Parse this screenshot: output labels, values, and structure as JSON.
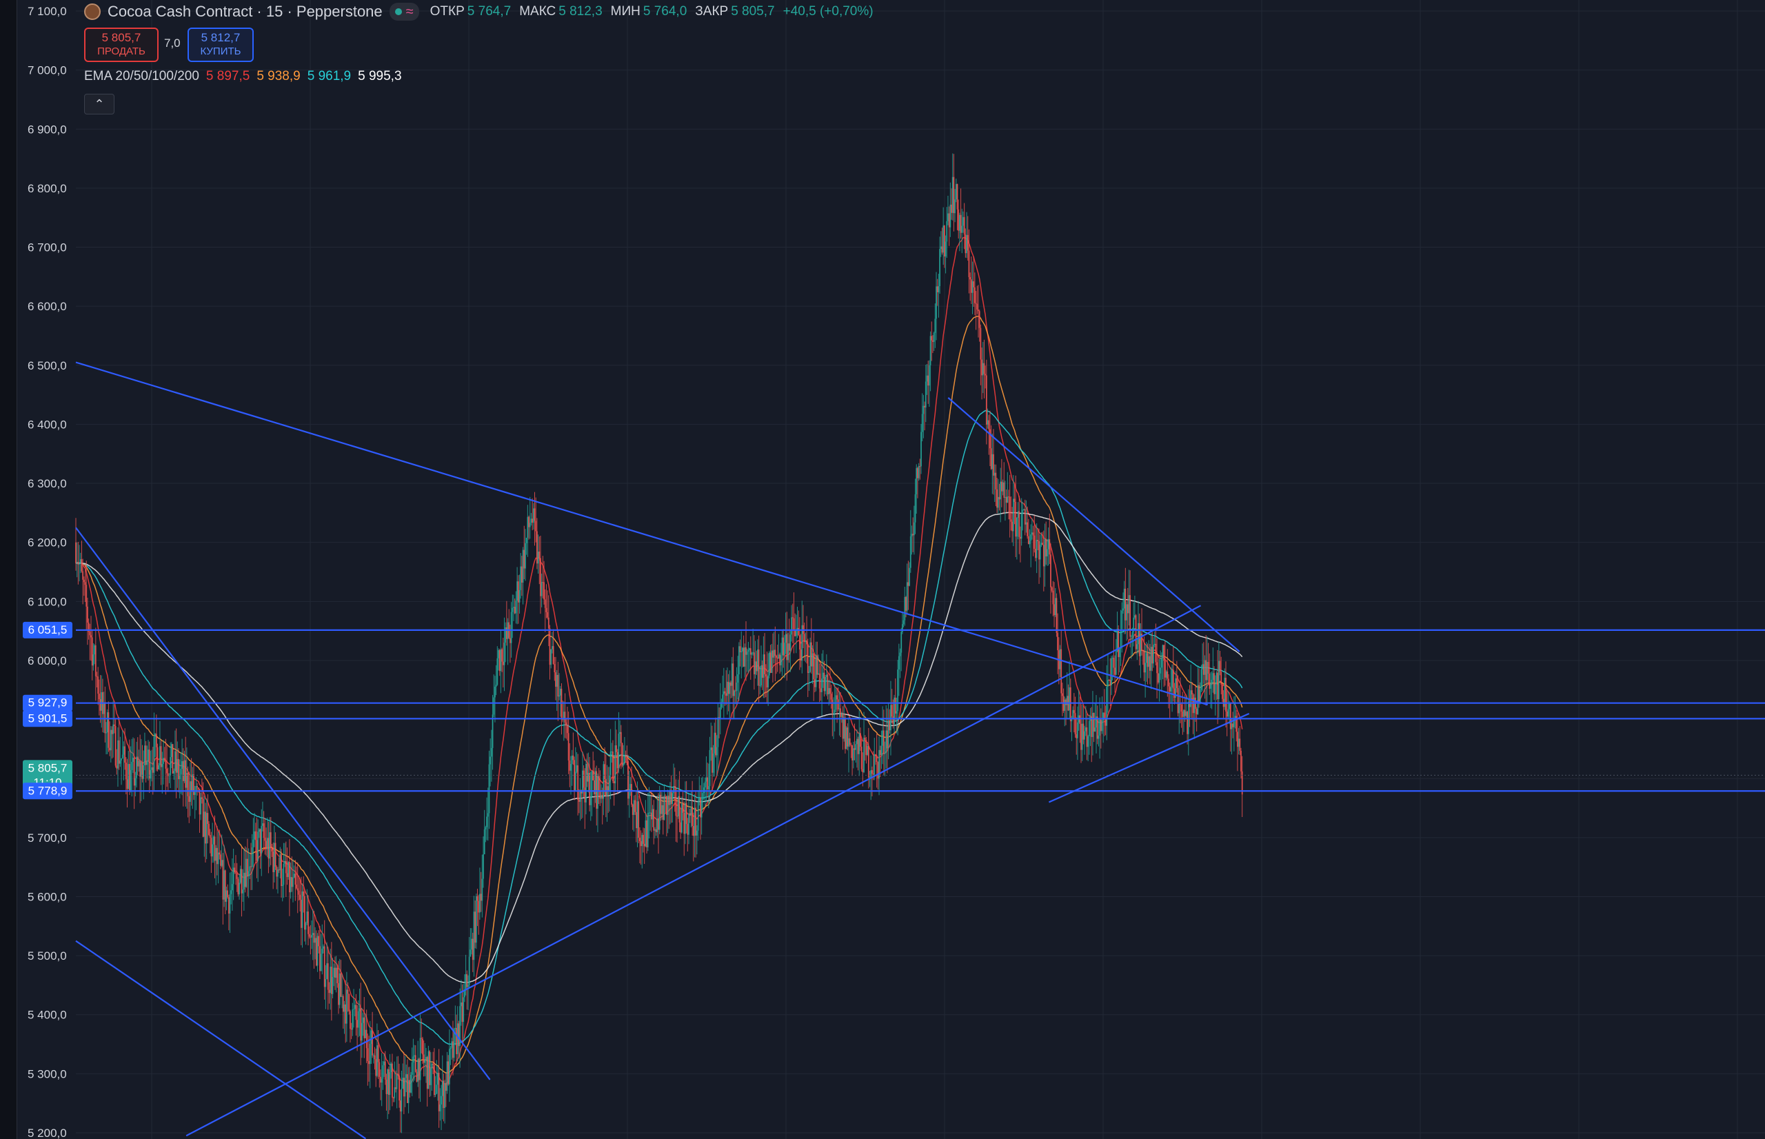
{
  "header": {
    "title": "Cocoa Cash Contract · 15 · Pepperstone",
    "ohlc": [
      {
        "key": "ОТКР",
        "value": "5 764,7"
      },
      {
        "key": "МАКС",
        "value": "5 812,3"
      },
      {
        "key": "МИН",
        "value": "5 764,0"
      },
      {
        "key": "ЗАКР",
        "value": "5 805,7"
      }
    ],
    "change": "+40,5 (+0,70%)"
  },
  "trade": {
    "sell_price": "5 805,7",
    "sell_label": "ПРОДАТЬ",
    "spread": "7,0",
    "buy_price": "5 812,7",
    "buy_label": "КУПИТЬ"
  },
  "ema": {
    "label": "EMA 20/50/100/200",
    "v20": "5 897,5",
    "v50": "5 938,9",
    "v100": "5 961,9",
    "v200": "5 995,3"
  },
  "colors": {
    "background": "#161b27",
    "grid": "#222836",
    "up": "#26a69a",
    "down": "#ef5350",
    "ema20": "#ef3b3b",
    "ema50": "#ff9a3c",
    "ema100": "#29d0d8",
    "ema200": "#e8e8e8",
    "drawing": "#2f5bff"
  },
  "icons": {
    "collapse": "chevron-up-icon",
    "logo": "cocoa-logo-icon"
  },
  "chart_data": {
    "type": "candlestick",
    "y_axis": {
      "min": 5200,
      "max": 7100,
      "ticks": [
        "7 100,0",
        "7 000,0",
        "6 900,0",
        "6 800,0",
        "6 700,0",
        "6 600,0",
        "6 500,0",
        "6 400,0",
        "6 300,0",
        "6 200,0",
        "6 100,0",
        "6 000,0",
        "5 700,0",
        "5 600,0",
        "5 500,0",
        "5 400,0",
        "5 300,0",
        "5 200,0"
      ],
      "tick_values": [
        7100,
        7000,
        6900,
        6800,
        6700,
        6600,
        6500,
        6400,
        6300,
        6200,
        6100,
        6000,
        5700,
        5600,
        5500,
        5400,
        5300,
        5200
      ]
    },
    "price_badges": [
      {
        "label": "6 051,5",
        "value": 6051.5,
        "color": "#2962ff"
      },
      {
        "label": "5 927,9",
        "value": 5927.9,
        "color": "#2962ff"
      },
      {
        "label": "5 901,5",
        "value": 5901.5,
        "color": "#2962ff"
      },
      {
        "label": "5 805,7",
        "sub": "11:10",
        "value": 5805.7,
        "color": "#26a69a"
      },
      {
        "label": "5 778,9",
        "value": 5778.9,
        "color": "#2962ff"
      }
    ],
    "horizontal_levels": [
      6051.5,
      5927.9,
      5901.5,
      5778.9
    ],
    "last_price": 5805.7,
    "trendlines": [
      {
        "t1": 0,
        "p1": 6505,
        "t2": 0.82,
        "p2": 5925
      },
      {
        "t1": 0,
        "p1": 6225,
        "t2": 0.3,
        "p2": 5290
      },
      {
        "t1": 0,
        "p1": 5525,
        "t2": 0.21,
        "p2": 5190
      },
      {
        "t1": 0.08,
        "p1": 5195,
        "t2": 0.815,
        "p2": 6093
      },
      {
        "t1": 0.705,
        "p1": 5760,
        "t2": 0.85,
        "p2": 5910
      },
      {
        "t1": 0.632,
        "p1": 6445,
        "t2": 0.843,
        "p2": 6015
      }
    ],
    "price_path": [
      {
        "t": 0,
        "p": 6200
      },
      {
        "t": 0.02,
        "p": 5900
      },
      {
        "t": 0.04,
        "p": 5800
      },
      {
        "t": 0.06,
        "p": 5850
      },
      {
        "t": 0.085,
        "p": 5780
      },
      {
        "t": 0.11,
        "p": 5600
      },
      {
        "t": 0.135,
        "p": 5700
      },
      {
        "t": 0.16,
        "p": 5600
      },
      {
        "t": 0.18,
        "p": 5480
      },
      {
        "t": 0.2,
        "p": 5400
      },
      {
        "t": 0.22,
        "p": 5320
      },
      {
        "t": 0.235,
        "p": 5260
      },
      {
        "t": 0.25,
        "p": 5330
      },
      {
        "t": 0.265,
        "p": 5260
      },
      {
        "t": 0.28,
        "p": 5400
      },
      {
        "t": 0.295,
        "p": 5650
      },
      {
        "t": 0.305,
        "p": 6000
      },
      {
        "t": 0.315,
        "p": 6050
      },
      {
        "t": 0.33,
        "p": 6250
      },
      {
        "t": 0.345,
        "p": 6000
      },
      {
        "t": 0.36,
        "p": 5800
      },
      {
        "t": 0.38,
        "p": 5780
      },
      {
        "t": 0.395,
        "p": 5850
      },
      {
        "t": 0.41,
        "p": 5700
      },
      {
        "t": 0.43,
        "p": 5760
      },
      {
        "t": 0.45,
        "p": 5720
      },
      {
        "t": 0.465,
        "p": 5880
      },
      {
        "t": 0.48,
        "p": 6000
      },
      {
        "t": 0.5,
        "p": 5980
      },
      {
        "t": 0.52,
        "p": 6050
      },
      {
        "t": 0.54,
        "p": 5970
      },
      {
        "t": 0.56,
        "p": 5860
      },
      {
        "t": 0.58,
        "p": 5820
      },
      {
        "t": 0.595,
        "p": 5940
      },
      {
        "t": 0.605,
        "p": 6200
      },
      {
        "t": 0.615,
        "p": 6450
      },
      {
        "t": 0.625,
        "p": 6650
      },
      {
        "t": 0.635,
        "p": 6800
      },
      {
        "t": 0.645,
        "p": 6700
      },
      {
        "t": 0.655,
        "p": 6550
      },
      {
        "t": 0.665,
        "p": 6300
      },
      {
        "t": 0.675,
        "p": 6250
      },
      {
        "t": 0.69,
        "p": 6220
      },
      {
        "t": 0.705,
        "p": 6180
      },
      {
        "t": 0.715,
        "p": 5950
      },
      {
        "t": 0.73,
        "p": 5870
      },
      {
        "t": 0.745,
        "p": 5900
      },
      {
        "t": 0.76,
        "p": 6100
      },
      {
        "t": 0.775,
        "p": 6000
      },
      {
        "t": 0.79,
        "p": 5990
      },
      {
        "t": 0.805,
        "p": 5900
      },
      {
        "t": 0.82,
        "p": 5990
      },
      {
        "t": 0.83,
        "p": 5960
      },
      {
        "t": 0.84,
        "p": 5880
      },
      {
        "t": 0.845,
        "p": 5806
      }
    ]
  }
}
